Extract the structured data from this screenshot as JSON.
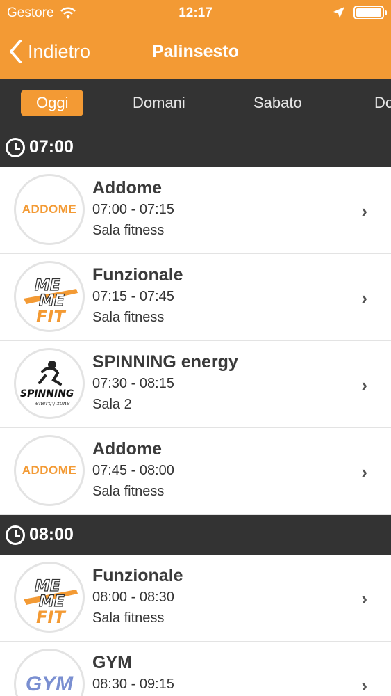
{
  "status_bar": {
    "carrier": "Gestore",
    "time": "12:17"
  },
  "nav": {
    "back_label": "Indietro",
    "title": "Palinsesto"
  },
  "tabs": [
    "Oggi",
    "Domani",
    "Sabato",
    "Do"
  ],
  "sections": [
    {
      "time": "07:00",
      "rows": [
        {
          "logo": "ADDOME",
          "name": "Addome",
          "time": "07:00 - 07:15",
          "room": "Sala fitness"
        },
        {
          "logo": "ME ME FIT",
          "name": "Funzionale",
          "time": "07:15 - 07:45",
          "room": "Sala fitness"
        },
        {
          "logo": "SPINNING",
          "logo_sub": "energy zone",
          "name": "SPINNING energy",
          "time": "07:30 - 08:15",
          "room": "Sala 2"
        },
        {
          "logo": "ADDOME",
          "name": "Addome",
          "time": "07:45 - 08:00",
          "room": "Sala fitness"
        }
      ]
    },
    {
      "time": "08:00",
      "rows": [
        {
          "logo": "ME ME FIT",
          "name": "Funzionale",
          "time": "08:00 - 08:30",
          "room": "Sala fitness"
        },
        {
          "logo": "GYM",
          "name": "GYM",
          "time": "08:30 - 09:15",
          "room": ""
        }
      ]
    }
  ],
  "colors": {
    "accent": "#f39a34",
    "dark": "#333333"
  }
}
